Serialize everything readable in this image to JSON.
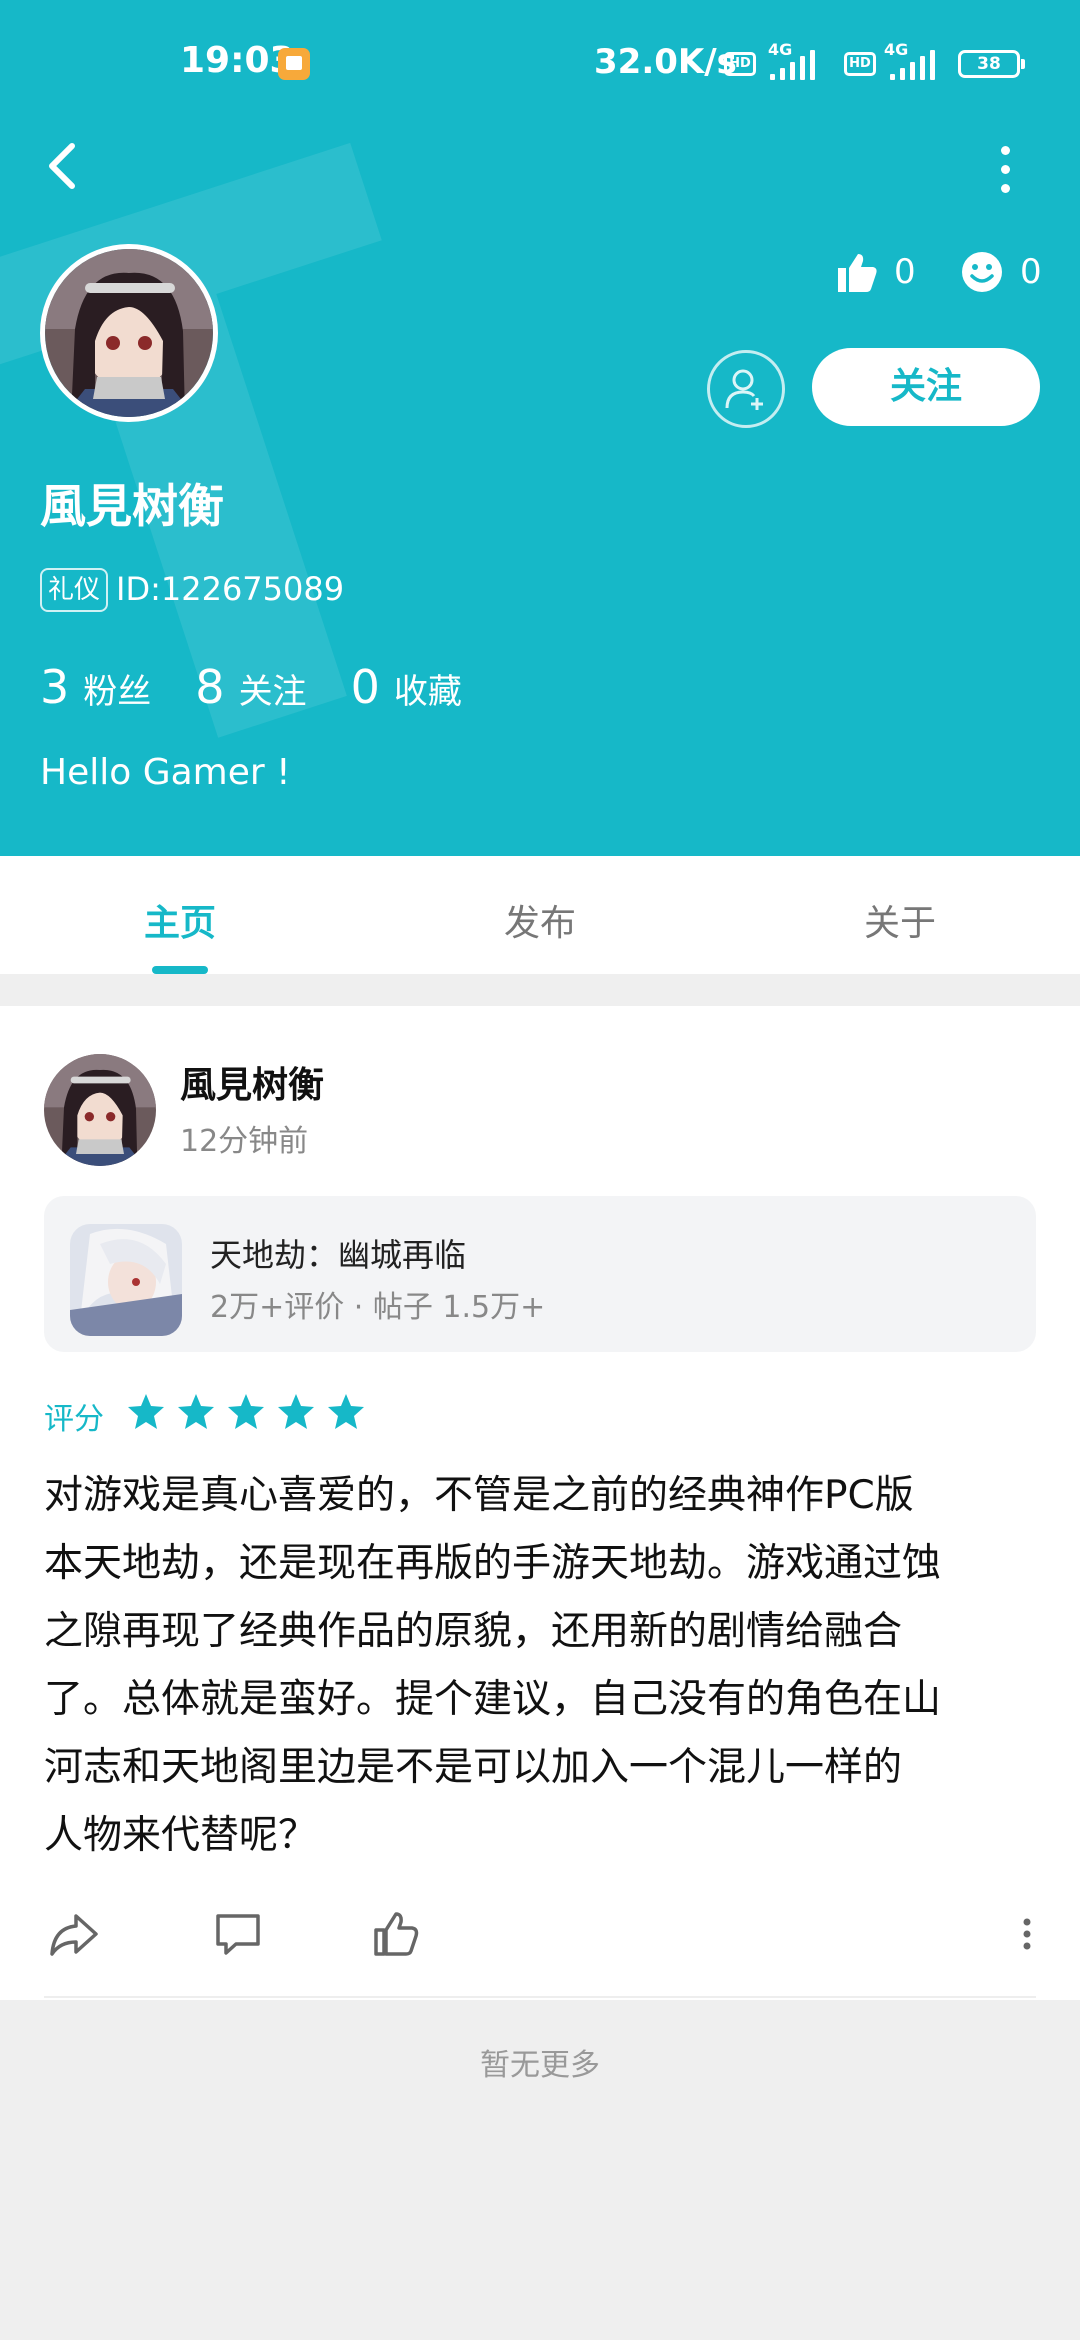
{
  "status_bar": {
    "time": "19:03",
    "speed": "32.0K/s",
    "hd": "HD",
    "network": "4G",
    "battery": "38"
  },
  "header": {
    "bg_color": "#16b8c8",
    "likes": "0",
    "reactions": "0",
    "follow_label": "关注",
    "user_name": "風見树衡",
    "badge": "礼仪",
    "user_id": "ID:122675089",
    "counts": [
      {
        "num": "3",
        "label": "粉丝"
      },
      {
        "num": "8",
        "label": "关注"
      },
      {
        "num": "0",
        "label": "收藏"
      }
    ],
    "bio": "Hello Gamer !"
  },
  "tabs": [
    {
      "label": "主页",
      "active": true
    },
    {
      "label": "发布",
      "active": false
    },
    {
      "label": "关于",
      "active": false
    }
  ],
  "post": {
    "author": "風見树衡",
    "time": "12分钟前",
    "game": {
      "title": "天地劫：幽城再临",
      "meta": "2万+评价 · 帖子 1.5万+"
    },
    "rating_label": "评分",
    "stars": 5,
    "lines": [
      "对游戏是真心喜爱的，不管是之前的经典神作PC版",
      "本天地劫，还是现在再版的手游天地劫。游戏通过蚀",
      "之隙再现了经典作品的原貌，还用新的剧情给融合",
      "了。总体就是蛮好。提个建议，自己没有的角色在山",
      "河志和天地阁里边是不是可以加入一个混儿一样的",
      "人物来代替呢？"
    ]
  },
  "footer": {
    "no_more": "暂无更多"
  }
}
